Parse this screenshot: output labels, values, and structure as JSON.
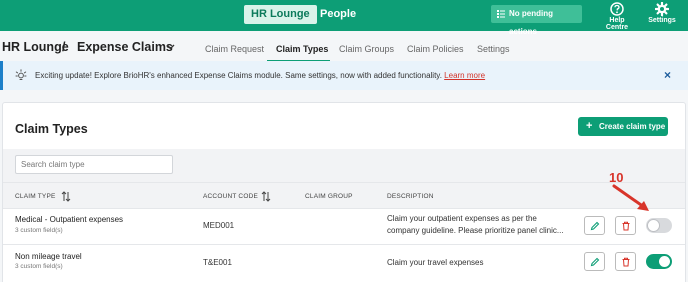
{
  "topbar": {
    "nav": [
      "HR Lounge",
      "People"
    ],
    "pending_label": "No pending actions",
    "help_label": "Help Centre",
    "settings_label": "Settings",
    "color": "#0d9e76"
  },
  "breadcrumb": {
    "root": "HR Lounge",
    "separator": "/",
    "current": "Expense Claims"
  },
  "tabs": [
    "Claim Request",
    "Claim Types",
    "Claim Groups",
    "Claim Policies",
    "Settings"
  ],
  "active_tab": "Claim Types",
  "banner": {
    "text": "Exciting update! Explore BrioHR's enhanced Expense Claims module. Same settings, now with added functionality.",
    "link": "Learn more",
    "close": "×"
  },
  "card": {
    "title": "Claim Types",
    "create_label": "Create claim type",
    "search_placeholder": "Search claim type"
  },
  "table": {
    "headers": [
      "CLAIM TYPE",
      "ACCOUNT CODE",
      "CLAIM GROUP",
      "DESCRIPTION"
    ],
    "rows": [
      {
        "name": "Medical - Outpatient expenses",
        "fields": "3 custom field(s)",
        "account_code": "MED001",
        "group": "",
        "desc_1": "Claim your outpatient expenses as per the",
        "desc_2": "company guideline. Please prioritize panel clinic...",
        "enabled": false
      },
      {
        "name": "Non mileage travel",
        "fields": "3 custom field(s)",
        "account_code": "T&E001",
        "group": "",
        "desc_1": "Claim your travel expenses",
        "enabled": true
      }
    ]
  },
  "annotation": {
    "label": "10",
    "color": "#d8342a"
  }
}
